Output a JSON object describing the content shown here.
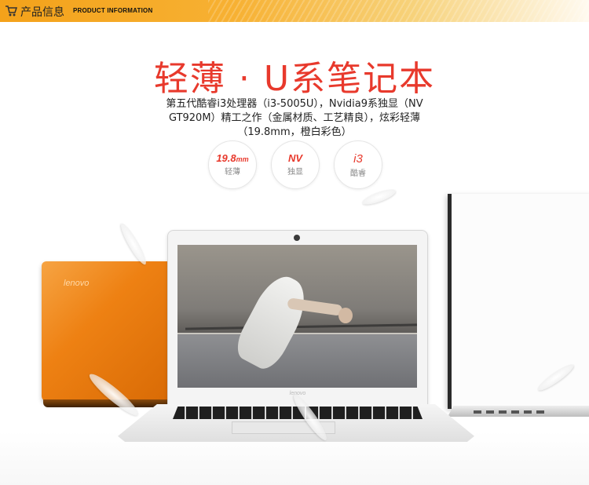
{
  "header": {
    "cart_icon": "cart-icon",
    "title_cn": "产品信息",
    "title_en": "PRODUCT INFORMATION",
    "colors": {
      "bar_start": "#f4a21a",
      "bar_end": "#fffaf0"
    }
  },
  "headline": {
    "text": "轻薄 · U系笔记本",
    "color": "#e8392c"
  },
  "description": "第五代酷睿i3处理器（i3-5005U），Nvidia9系独显（NV GT920M）精工之作（金属材质、工艺精良），炫彩轻薄（19.8mm，橙白彩色）",
  "features": [
    {
      "value": "19.8",
      "unit": "mm",
      "label": "轻薄"
    },
    {
      "value": "NV",
      "unit": "",
      "label": "独显"
    },
    {
      "value": "i3",
      "unit": "",
      "label": "酷睿"
    }
  ],
  "laptops": {
    "orange_logo": "lenovo",
    "center_logo": "lenovo"
  }
}
